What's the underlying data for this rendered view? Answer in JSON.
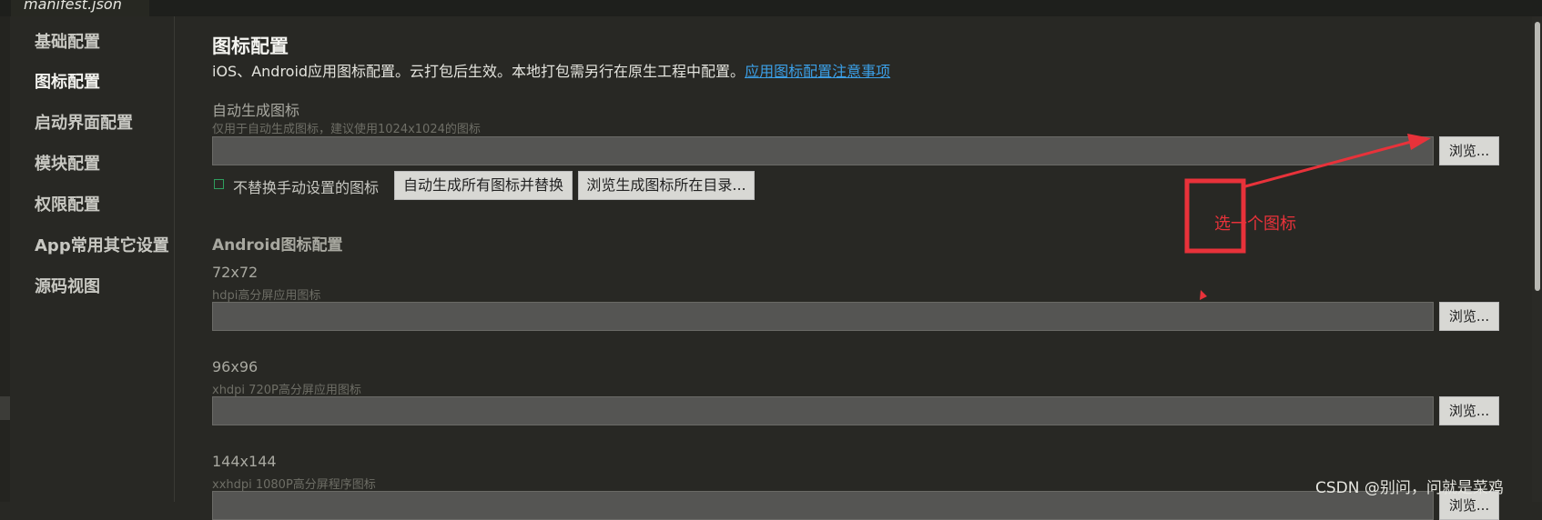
{
  "tab": {
    "filename": "manifest.json"
  },
  "sidebar": {
    "items": [
      {
        "label": "基础配置"
      },
      {
        "label": "图标配置"
      },
      {
        "label": "启动界面配置"
      },
      {
        "label": "模块配置"
      },
      {
        "label": "权限配置"
      },
      {
        "label": "App常用其它设置"
      },
      {
        "label": "源码视图"
      }
    ],
    "active_index": 1
  },
  "main": {
    "title": "图标配置",
    "description": "iOS、Android应用图标配置。云打包后生效。本地打包需另行在原生工程中配置。",
    "link": "应用图标配置注意事项",
    "auto": {
      "label": "自动生成图标",
      "hint": "仅用于自动生成图标，建议使用1024x1024的图标",
      "value": "",
      "browse": "浏览..."
    },
    "checkbox_label": "不替换手动设置的图标",
    "checkbox_checked": false,
    "generate_button": "自动生成所有图标并替换",
    "browse_dir_button": "浏览生成图标所在目录...",
    "android": {
      "section_title": "Android图标配置",
      "fields": [
        {
          "label": "72x72",
          "hint": "hdpi高分屏应用图标",
          "value": "",
          "browse": "浏览..."
        },
        {
          "label": "96x96",
          "hint": "xhdpi 720P高分屏应用图标",
          "value": "",
          "browse": "浏览..."
        },
        {
          "label": "144x144",
          "hint": "xxhdpi 1080P高分屏程序图标",
          "value": "",
          "browse": "浏览..."
        }
      ]
    }
  },
  "annotation": {
    "text": "选一个图标",
    "color": "#e8323a"
  },
  "watermark": "CSDN @别问，问就是菜鸡",
  "colors": {
    "background": "#282824",
    "link": "#3b9fe6",
    "annotation": "#e8323a"
  }
}
